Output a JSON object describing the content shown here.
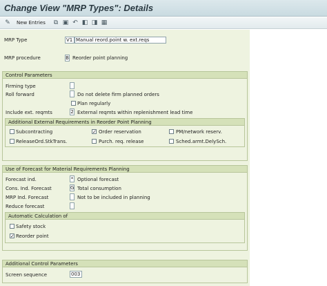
{
  "window": {
    "title": "Change View \"MRP Types\": Details"
  },
  "toolbar": {
    "new_entries_label": "New Entries",
    "icons": [
      "edit-icon",
      "copy-icon",
      "delete-icon",
      "undo-icon",
      "previous-icon",
      "next-icon",
      "export-icon"
    ]
  },
  "header": {
    "mrp_type_label": "MRP Type",
    "mrp_type_value": "V1",
    "mrp_type_desc": "Manual reord.point w. ext.reqs",
    "mrp_procedure_label": "MRP procedure",
    "mrp_procedure_value": "B",
    "mrp_procedure_desc": "Reorder point planning"
  },
  "control_params": {
    "title": "Control Parameters",
    "firming_type_label": "Firming type",
    "firming_type_value": "",
    "roll_forward_label": "Roll forward",
    "roll_forward_value": "",
    "roll_forward_desc": "Do not delete firm planned orders",
    "plan_regularly_label": "Plan regularly",
    "plan_regularly_checked": false,
    "include_ext_label": "Include ext. reqmts",
    "include_ext_value": "2",
    "include_ext_desc": "External reqmts within replenishment lead time",
    "additional": {
      "title": "Additional External Requirements in Reorder Point Planning",
      "items": [
        {
          "label": "Subcontracting",
          "checked": false
        },
        {
          "label": "Order reservation",
          "checked": true
        },
        {
          "label": "PM/network reserv.",
          "checked": false
        },
        {
          "label": "ReleaseOrd.StkTrans.",
          "checked": false
        },
        {
          "label": "Purch. req. release",
          "checked": false
        },
        {
          "label": "Sched.armt.DelySch.",
          "checked": false
        }
      ]
    }
  },
  "forecast": {
    "title": "Use of Forecast for Material Requirements Planning",
    "forecast_ind_label": "Forecast ind.",
    "forecast_ind_value": "*",
    "forecast_ind_desc": "Optional forecast",
    "cons_ind_label": "Cons. Ind. Forecast",
    "cons_ind_value": "G",
    "cons_ind_desc": "Total consumption",
    "mrp_ind_label": "MRP Ind. Forecast",
    "mrp_ind_value": "",
    "mrp_ind_desc": "Not to be included in planning",
    "reduce_label": "Reduce forecast",
    "reduce_value": "",
    "auto_calc": {
      "title": "Automatic Calculation of",
      "safety_stock_label": "Safety stock",
      "safety_stock_checked": false,
      "reorder_point_label": "Reorder point",
      "reorder_point_checked": true
    }
  },
  "additional_control": {
    "title": "Additional Control Parameters",
    "screen_seq_label": "Screen sequence",
    "screen_seq_value": "003"
  }
}
